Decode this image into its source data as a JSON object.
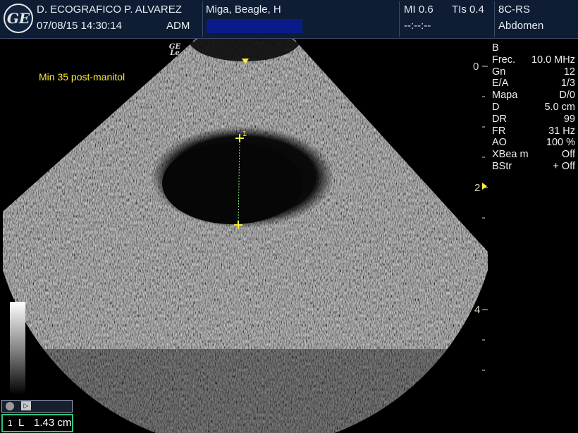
{
  "header": {
    "logo": "GE",
    "facility": "D. ECOGRAFICO P. ALVAREZ",
    "datetime": "07/08/15 14:30:14",
    "operator": "ADM",
    "patient": "Miga, Beagle, H",
    "mi": "MI 0.6",
    "tis": "TIs 0.4",
    "mi_value_time": "--:--:--",
    "probe": "8C-RS",
    "preset": "Abdomen"
  },
  "image": {
    "annotation": "Min 35 post-manitol",
    "probe_logo_line1": "GE",
    "probe_logo_line2": "Le",
    "caliper_label": "1",
    "depth_marks": [
      "0",
      "2",
      "4"
    ]
  },
  "params": {
    "mode": "B",
    "rows": [
      {
        "k": "Frec.",
        "v": "10.0 MHz"
      },
      {
        "k": "Gn",
        "v": "12"
      },
      {
        "k": "E/A",
        "v": "1/3"
      },
      {
        "k": "Mapa",
        "v": "D/0"
      },
      {
        "k": "D",
        "v": "5.0 cm"
      },
      {
        "k": "DR",
        "v": "99"
      },
      {
        "k": "FR",
        "v": "31 Hz"
      },
      {
        "k": "AO",
        "v": "100 %"
      },
      {
        "k": "XBea m",
        "v": "Off"
      },
      {
        "k": "BStr",
        "v": "+ Off"
      }
    ]
  },
  "measurement": {
    "index": "1",
    "type": "L",
    "value": "1.43 cm"
  },
  "colors": {
    "header_bg": "#0e1d33",
    "annotation": "#ffeb3b",
    "caliper": "#ffeb3b",
    "measure_border": "#2ec27e"
  }
}
